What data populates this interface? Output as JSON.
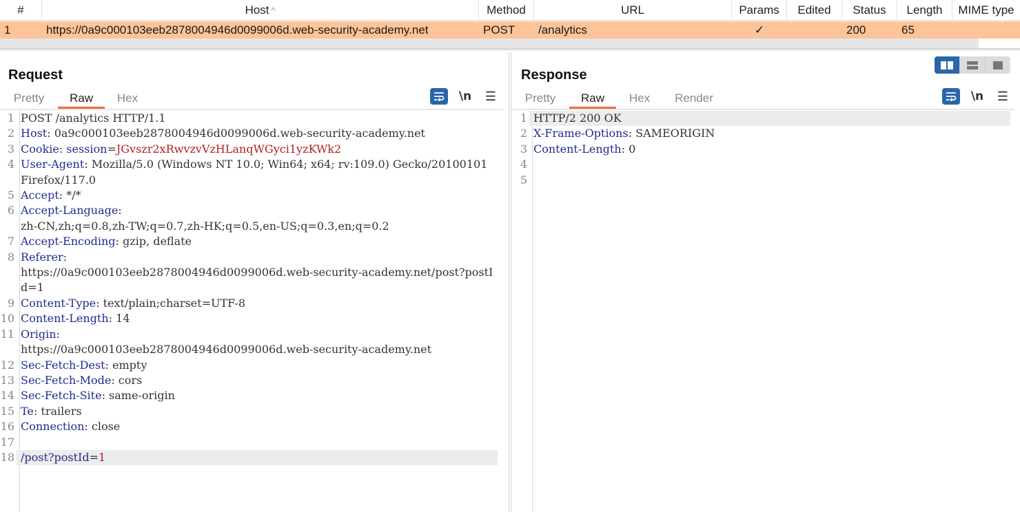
{
  "table": {
    "columns": [
      {
        "key": "num",
        "label": "#"
      },
      {
        "key": "host",
        "label": "Host",
        "sort": "ascending"
      },
      {
        "key": "method",
        "label": "Method"
      },
      {
        "key": "url",
        "label": "URL"
      },
      {
        "key": "params",
        "label": "Params"
      },
      {
        "key": "edited",
        "label": "Edited"
      },
      {
        "key": "status",
        "label": "Status"
      },
      {
        "key": "length",
        "label": "Length"
      },
      {
        "key": "mime",
        "label": "MIME type"
      }
    ],
    "sort_icon": "caret-up-icon",
    "rows": [
      {
        "num": "1",
        "host": "https://0a9c000103eeb2878004946d0099006d.web-security-academy.net",
        "method": "POST",
        "url": "/analytics",
        "params": "✓",
        "edited": "",
        "status": "200",
        "length": "65",
        "mime": ""
      }
    ],
    "selected_row_color": "#fdc498"
  },
  "request": {
    "title": "Request",
    "tabs": [
      "Pretty",
      "Raw",
      "Hex"
    ],
    "active_tab": "Raw",
    "tools": {
      "wrap_icon": "word-wrap-icon",
      "newline_label": "\\n",
      "menu_icon": "hamburger-menu-icon"
    },
    "lines": [
      {
        "n": "1",
        "parts": [
          {
            "t": "POST /analytics HTTP/1.1",
            "c": "v"
          }
        ]
      },
      {
        "n": "2",
        "parts": [
          {
            "t": "Host",
            "c": "k"
          },
          {
            "t": ": 0a9c000103eeb2878004946d0099006d.web-security-academy.net",
            "c": "v"
          }
        ]
      },
      {
        "n": "3",
        "parts": [
          {
            "t": "Cookie",
            "c": "k"
          },
          {
            "t": ": ",
            "c": "v"
          },
          {
            "t": "session",
            "c": "ck"
          },
          {
            "t": "=",
            "c": "v"
          },
          {
            "t": "JGvszr2xRwvzvVzHLanqWGyci1yzKWk2",
            "c": "cv"
          }
        ]
      },
      {
        "n": "4",
        "parts": [
          {
            "t": "User-Agent",
            "c": "k"
          },
          {
            "t": ": Mozilla/5.0 (Windows NT 10.0; Win64; x64; rv:109.0) Gecko/20100101 Firefox/117.0",
            "c": "v"
          }
        ]
      },
      {
        "n": "5",
        "parts": [
          {
            "t": "Accept",
            "c": "k"
          },
          {
            "t": ": */*",
            "c": "v"
          }
        ]
      },
      {
        "n": "6",
        "parts": [
          {
            "t": "Accept-Language",
            "c": "k"
          },
          {
            "t": ":\nzh-CN,zh;q=0.8,zh-TW;q=0.7,zh-HK;q=0.5,en-US;q=0.3,en;q=0.2",
            "c": "v"
          }
        ]
      },
      {
        "n": "7",
        "parts": [
          {
            "t": "Accept-Encoding",
            "c": "k"
          },
          {
            "t": ": gzip, deflate",
            "c": "v"
          }
        ]
      },
      {
        "n": "8",
        "parts": [
          {
            "t": "Referer",
            "c": "k"
          },
          {
            "t": ":\nhttps://0a9c000103eeb2878004946d0099006d.web-security-academy.net/post?postId=1",
            "c": "v"
          }
        ]
      },
      {
        "n": "9",
        "parts": [
          {
            "t": "Content-Type",
            "c": "k"
          },
          {
            "t": ": text/plain;charset=UTF-8",
            "c": "v"
          }
        ]
      },
      {
        "n": "10",
        "parts": [
          {
            "t": "Content-Length",
            "c": "k"
          },
          {
            "t": ": 14",
            "c": "v"
          }
        ]
      },
      {
        "n": "11",
        "parts": [
          {
            "t": "Origin",
            "c": "k"
          },
          {
            "t": ":\nhttps://0a9c000103eeb2878004946d0099006d.web-security-academy.net",
            "c": "v"
          }
        ]
      },
      {
        "n": "12",
        "parts": [
          {
            "t": "Sec-Fetch-Dest",
            "c": "k"
          },
          {
            "t": ": empty",
            "c": "v"
          }
        ]
      },
      {
        "n": "13",
        "parts": [
          {
            "t": "Sec-Fetch-Mode",
            "c": "k"
          },
          {
            "t": ": cors",
            "c": "v"
          }
        ]
      },
      {
        "n": "14",
        "parts": [
          {
            "t": "Sec-Fetch-Site",
            "c": "k"
          },
          {
            "t": ": same-origin",
            "c": "v"
          }
        ]
      },
      {
        "n": "15",
        "parts": [
          {
            "t": "Te",
            "c": "k"
          },
          {
            "t": ": trailers",
            "c": "v"
          }
        ]
      },
      {
        "n": "16",
        "parts": [
          {
            "t": "Connection",
            "c": "k"
          },
          {
            "t": ": close",
            "c": "v"
          }
        ]
      },
      {
        "n": "17",
        "parts": [
          {
            "t": "",
            "c": "v"
          }
        ]
      },
      {
        "n": "18",
        "hl": true,
        "parts": [
          {
            "t": "/post?postId",
            "c": "pk"
          },
          {
            "t": "=",
            "c": "v"
          },
          {
            "t": "1",
            "c": "pv"
          }
        ]
      }
    ]
  },
  "response": {
    "title": "Response",
    "tabs": [
      "Pretty",
      "Raw",
      "Hex",
      "Render"
    ],
    "active_tab": "Raw",
    "tools": {
      "wrap_icon": "word-wrap-icon",
      "newline_label": "\\n",
      "menu_icon": "hamburger-menu-icon"
    },
    "layout_toggle": {
      "options": [
        "side-by-side",
        "stacked",
        "single"
      ],
      "active": "side-by-side"
    },
    "lines": [
      {
        "n": "1",
        "hl": true,
        "parts": [
          {
            "t": "HTTP/2 200 OK",
            "c": "v"
          }
        ]
      },
      {
        "n": "2",
        "parts": [
          {
            "t": "X-Frame-Options",
            "c": "k"
          },
          {
            "t": ": SAMEORIGIN",
            "c": "v"
          }
        ]
      },
      {
        "n": "3",
        "parts": [
          {
            "t": "Content-Length",
            "c": "k"
          },
          {
            "t": ": 0",
            "c": "v"
          }
        ]
      },
      {
        "n": "4",
        "parts": [
          {
            "t": "",
            "c": "v"
          }
        ]
      },
      {
        "n": "5",
        "parts": [
          {
            "t": "",
            "c": "v"
          }
        ]
      }
    ]
  },
  "colors": {
    "accent_blue": "#2a66a8",
    "tab_underline": "#f26a3d",
    "header_key": "#1f2c8f",
    "value_red": "#b0201f"
  }
}
